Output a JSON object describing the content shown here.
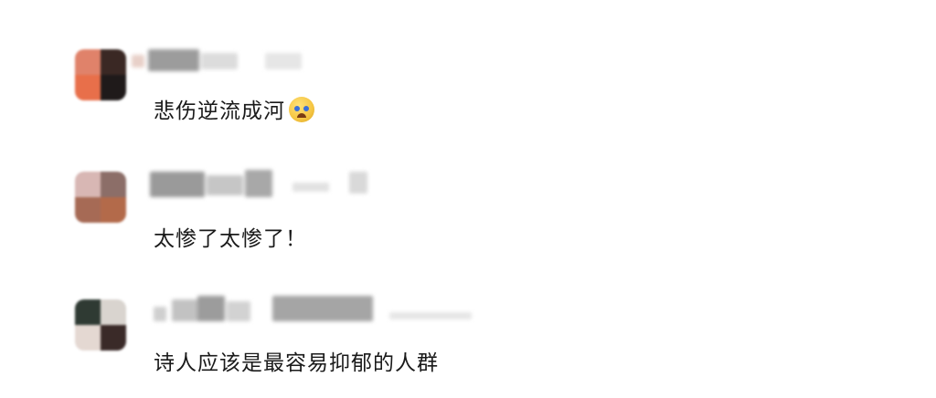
{
  "comments": [
    {
      "text": "悲伤逆流成河",
      "emoji": "loudly-crying-face-icon"
    },
    {
      "text": "太惨了太惨了！"
    },
    {
      "text": "诗人应该是最容易抑郁的人群"
    }
  ],
  "colors": {
    "text": "#1a1a1a",
    "background": "#ffffff"
  }
}
